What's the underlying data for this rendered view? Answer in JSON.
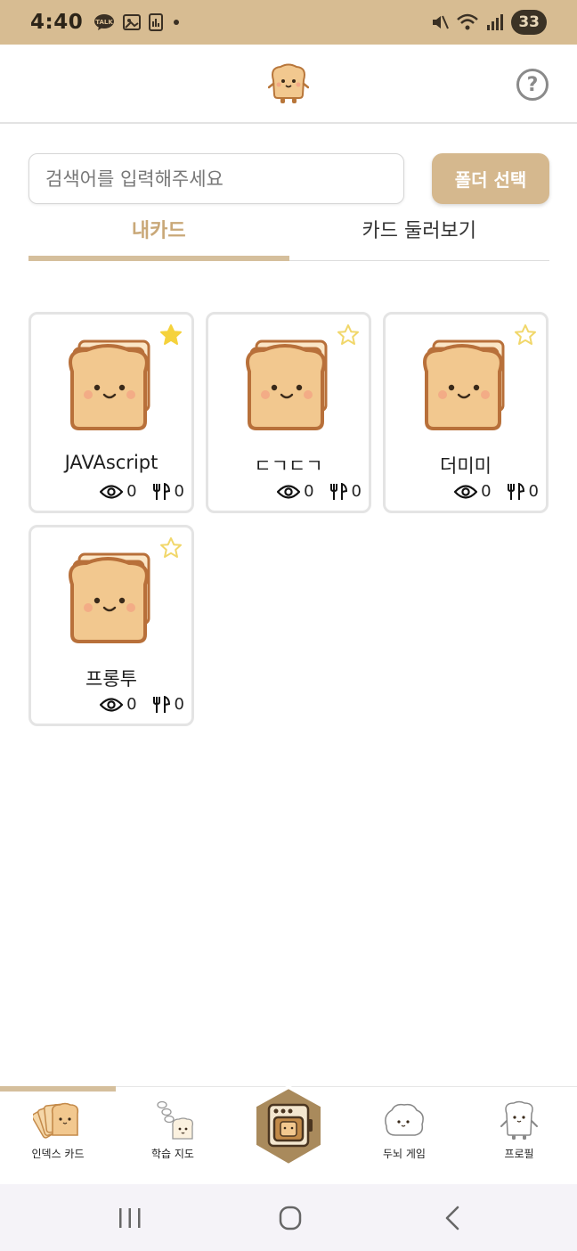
{
  "status_bar": {
    "time": "4:40",
    "battery": "33",
    "icons": [
      "talk-icon",
      "gallery-icon",
      "stats-icon",
      "dot-icon",
      "mute-icon",
      "wifi-icon",
      "signal-icon"
    ]
  },
  "header": {
    "logo": "toast-mascot-icon",
    "help_label": "?"
  },
  "search": {
    "placeholder": "검색어를 입력해주세요",
    "value": ""
  },
  "folder_button": {
    "label": "폴더 선택"
  },
  "tabs": [
    {
      "label": "내카드",
      "active": true
    },
    {
      "label": "카드 둘러보기",
      "active": false
    }
  ],
  "cards": [
    {
      "title": "JAVAscript",
      "starred": true,
      "views": "0",
      "forks": "0"
    },
    {
      "title": "ㄷㄱㄷㄱ",
      "starred": false,
      "views": "0",
      "forks": "0"
    },
    {
      "title": "더미미",
      "starred": false,
      "views": "0",
      "forks": "0"
    },
    {
      "title": "프롱투",
      "starred": false,
      "views": "0",
      "forks": "0"
    }
  ],
  "bottom_nav": {
    "items": [
      {
        "label": "인덱스 카드",
        "icon": "index-cards-icon",
        "active": true
      },
      {
        "label": "학습 지도",
        "icon": "learning-map-icon",
        "active": false
      },
      {
        "label": "",
        "icon": "oven-icon",
        "active": false
      },
      {
        "label": "두뇌 게임",
        "icon": "brain-game-icon",
        "active": false
      },
      {
        "label": "프로필",
        "icon": "profile-icon",
        "active": false
      }
    ]
  },
  "colors": {
    "status_bar": "#d7bc92",
    "accent": "#d5b88e",
    "tab_active_text": "#c9a878",
    "star_filled": "#f5d23c",
    "star_outline": "#f1d76a",
    "toast_crust": "#c97f3a",
    "toast_body": "#f2c88f"
  }
}
